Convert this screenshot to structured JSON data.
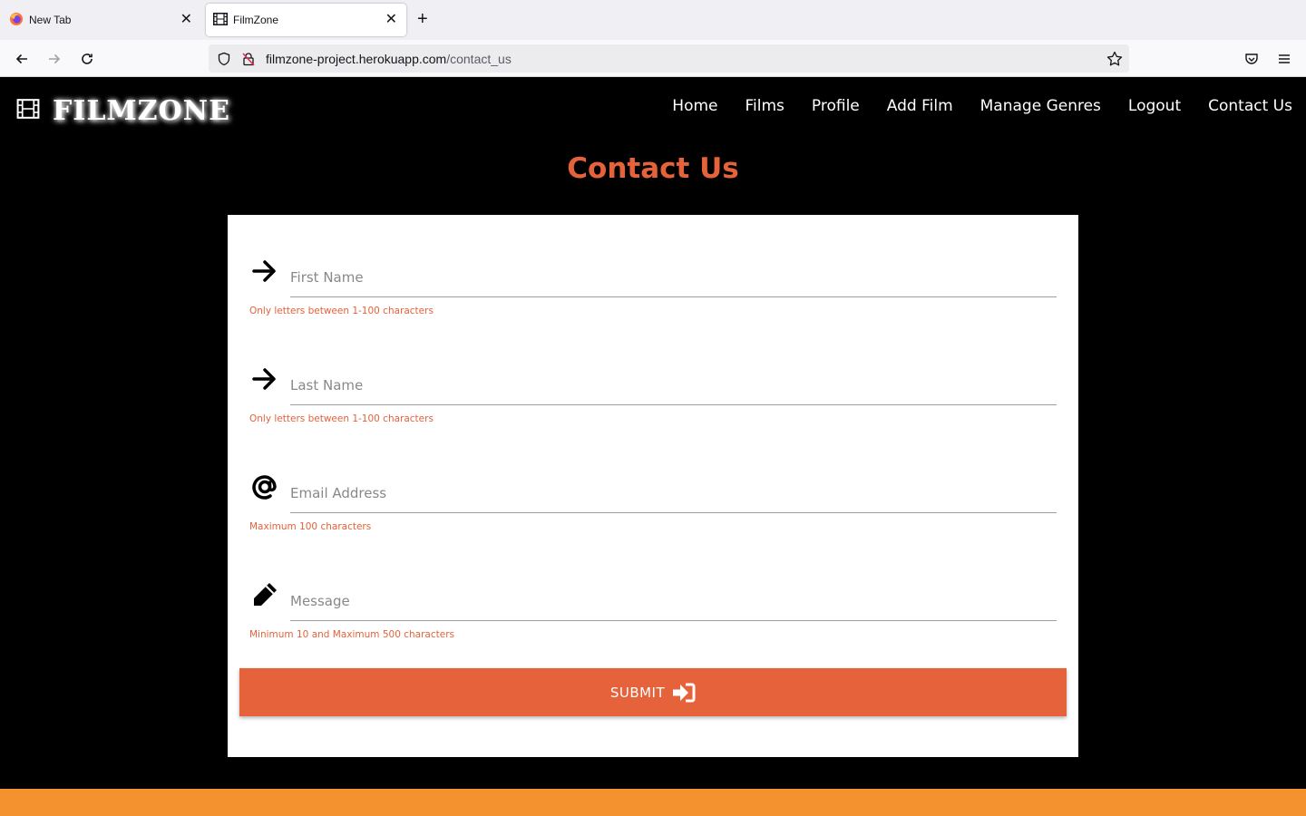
{
  "browser": {
    "tabs": [
      {
        "title": "New Tab",
        "active": false
      },
      {
        "title": "FilmZone",
        "active": true
      }
    ],
    "url_host": "filmzone-project.herokuapp.com",
    "url_path": "/contact_us"
  },
  "site": {
    "brand": "FILMZONE",
    "nav": [
      "Home",
      "Films",
      "Profile",
      "Add Film",
      "Manage Genres",
      "Logout",
      "Contact Us"
    ]
  },
  "page": {
    "title": "Contact Us",
    "fields": [
      {
        "icon": "arrow-right-icon",
        "placeholder": "First Name",
        "helper": "Only letters between 1-100 characters"
      },
      {
        "icon": "arrow-right-icon",
        "placeholder": "Last Name",
        "helper": "Only letters between 1-100 characters"
      },
      {
        "icon": "at-sign-icon",
        "placeholder": "Email Address",
        "helper": "Maximum 100 characters"
      },
      {
        "icon": "pencil-icon",
        "placeholder": "Message",
        "helper": "Minimum 10 and Maximum 500 characters"
      }
    ],
    "submit_label": "SUBMIT"
  },
  "colors": {
    "accent": "#e5623a",
    "footer": "#f3922e",
    "header_bg": "#000000"
  }
}
